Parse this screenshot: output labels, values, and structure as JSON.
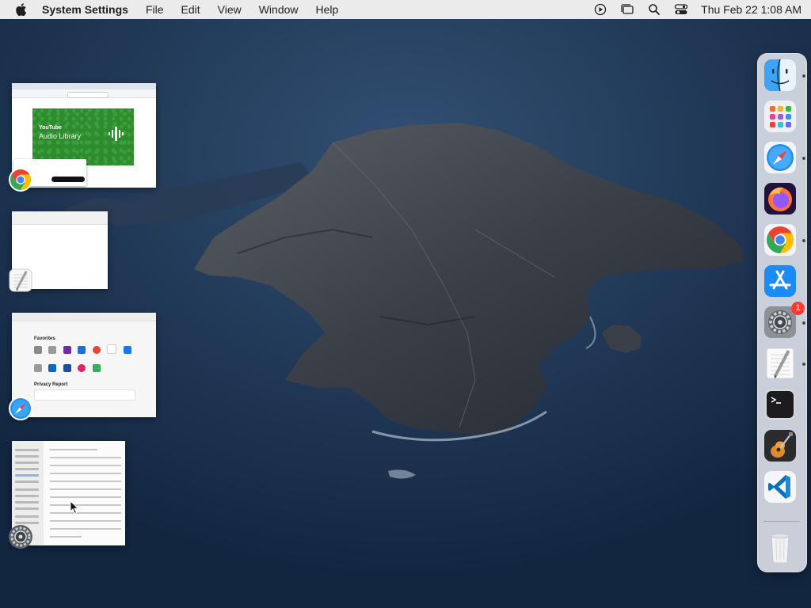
{
  "menubar": {
    "app_name": "System Settings",
    "items": [
      "File",
      "Edit",
      "View",
      "Window"
    ],
    "help": "Help",
    "clock": "Thu Feb 22  1:08 AM",
    "status_icons": [
      "play-circle-icon",
      "stage-manager-icon",
      "search-icon",
      "control-center-icon"
    ]
  },
  "stage_manager": {
    "windows": [
      {
        "app": "Google Chrome",
        "icon": "chrome-icon",
        "hero_title": "YouTube",
        "hero_subtitle": "Audio Library"
      },
      {
        "app": "TextEdit",
        "icon": "textedit-icon"
      },
      {
        "app": "Safari",
        "icon": "safari-icon",
        "favorites_heading": "Favorites",
        "privacy_heading": "Privacy Report"
      },
      {
        "app": "System Settings",
        "icon": "system-settings-icon"
      }
    ]
  },
  "dock": {
    "items": [
      {
        "name": "Finder",
        "icon": "finder-icon",
        "running": true
      },
      {
        "name": "Launchpad",
        "icon": "launchpad-icon",
        "running": false
      },
      {
        "name": "Safari",
        "icon": "safari-icon",
        "running": true
      },
      {
        "name": "Firefox",
        "icon": "firefox-icon",
        "running": false
      },
      {
        "name": "Google Chrome",
        "icon": "chrome-icon",
        "running": true
      },
      {
        "name": "App Store",
        "icon": "app-store-icon",
        "running": false
      },
      {
        "name": "System Settings",
        "icon": "system-settings-icon",
        "running": true,
        "badge": "1"
      },
      {
        "name": "TextEdit",
        "icon": "textedit-icon",
        "running": true
      },
      {
        "name": "Terminal",
        "icon": "terminal-icon",
        "running": false
      },
      {
        "name": "GarageBand",
        "icon": "garageband-icon",
        "running": false
      },
      {
        "name": "Visual Studio Code",
        "icon": "vscode-icon",
        "running": false
      },
      {
        "name": "Trash",
        "icon": "trash-icon",
        "running": false
      }
    ]
  },
  "colors": {
    "menubar_bg": "#ebebeb",
    "desktop_bg": "#1d3553",
    "badge": "#ff3b30"
  }
}
